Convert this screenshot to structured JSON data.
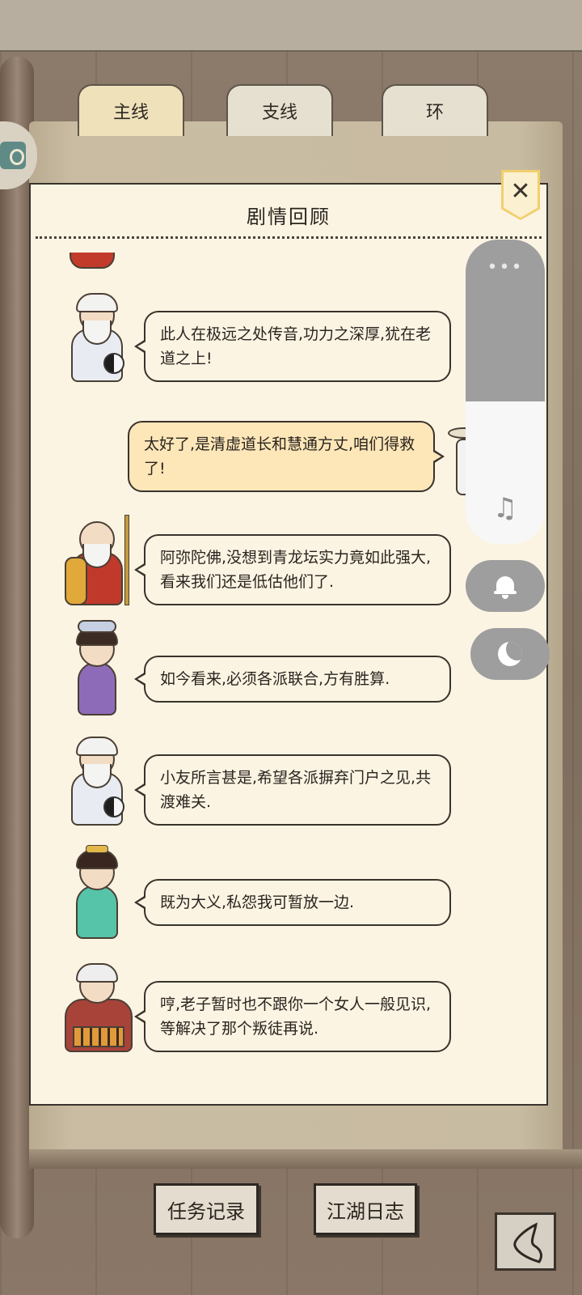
{
  "tabs": [
    {
      "label": "主线",
      "active": true
    },
    {
      "label": "支线",
      "active": false
    },
    {
      "label": "环",
      "active": false
    }
  ],
  "dialog": {
    "title": "剧情回顾",
    "close_icon": "close-icon"
  },
  "entries": [
    {
      "speaker": "qingxu-taoist",
      "side": "npc",
      "text": "此人在极远之处传音,功力之深厚,犹在老道之上!"
    },
    {
      "speaker": "player",
      "side": "player",
      "text": "太好了,是清虚道长和慧通方丈,咱们得救了!"
    },
    {
      "speaker": "huitong-abbot",
      "side": "npc",
      "text": "阿弥陀佛,没想到青龙坛实力竟如此强大,看来我们还是低估他们了."
    },
    {
      "speaker": "purple-girl",
      "side": "npc",
      "text": "如今看来,必须各派联合,方有胜算."
    },
    {
      "speaker": "qingxu-taoist",
      "side": "npc",
      "text": "小友所言甚是,希望各派摒弃门户之见,共渡难关."
    },
    {
      "speaker": "green-lady",
      "side": "npc",
      "text": "既为大义,私怨我可暂放一边."
    },
    {
      "speaker": "tiger-warrior",
      "side": "npc",
      "text": "哼,老子暂时也不跟你一个女人一般见识,等解决了那个叛徒再说."
    }
  ],
  "bottom": {
    "task_record": "任务记录",
    "jianghu_log": "江湖日志"
  },
  "overlay": {
    "menu_icon": "more-dots-icon",
    "music_icon": "music-note-icon",
    "bell_icon": "bell-icon",
    "moon_icon": "moon-icon",
    "dots": "•••",
    "note": "♫"
  },
  "colors": {
    "parchment": "#fbf4e3",
    "player_bubble": "#fde6b8",
    "active_tab": "#efe2bb",
    "close_badge": "#f2cf6d"
  }
}
